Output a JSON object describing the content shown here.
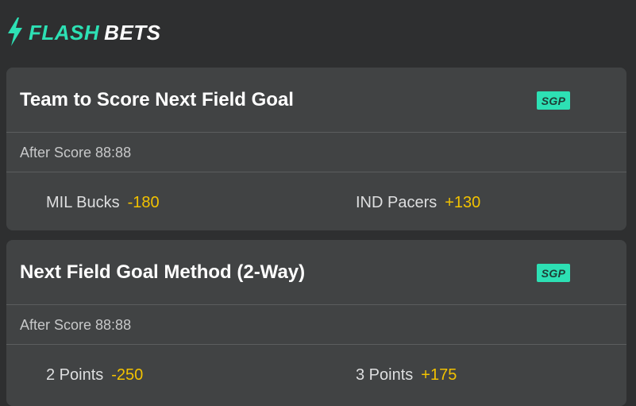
{
  "header": {
    "brand_flash": "FLASH",
    "brand_bets": "BETS",
    "icon": "lightning-bolt-icon",
    "accent_color": "#2de0b4"
  },
  "markets": [
    {
      "title": "Team to Score Next Field Goal",
      "badge": "SGP",
      "subtitle": "After Score 88:88",
      "outcomes": [
        {
          "name": "MIL Bucks",
          "odds": "-180"
        },
        {
          "name": "IND Pacers",
          "odds": "+130"
        }
      ]
    },
    {
      "title": "Next Field Goal Method (2-Way)",
      "badge": "SGP",
      "subtitle": "After Score 88:88",
      "outcomes": [
        {
          "name": "2 Points",
          "odds": "-250"
        },
        {
          "name": "3 Points",
          "odds": "+175"
        }
      ]
    }
  ],
  "colors": {
    "background": "#2e2f30",
    "card": "#414344",
    "odds": "#f2c200",
    "badge": "#2de0b4"
  }
}
